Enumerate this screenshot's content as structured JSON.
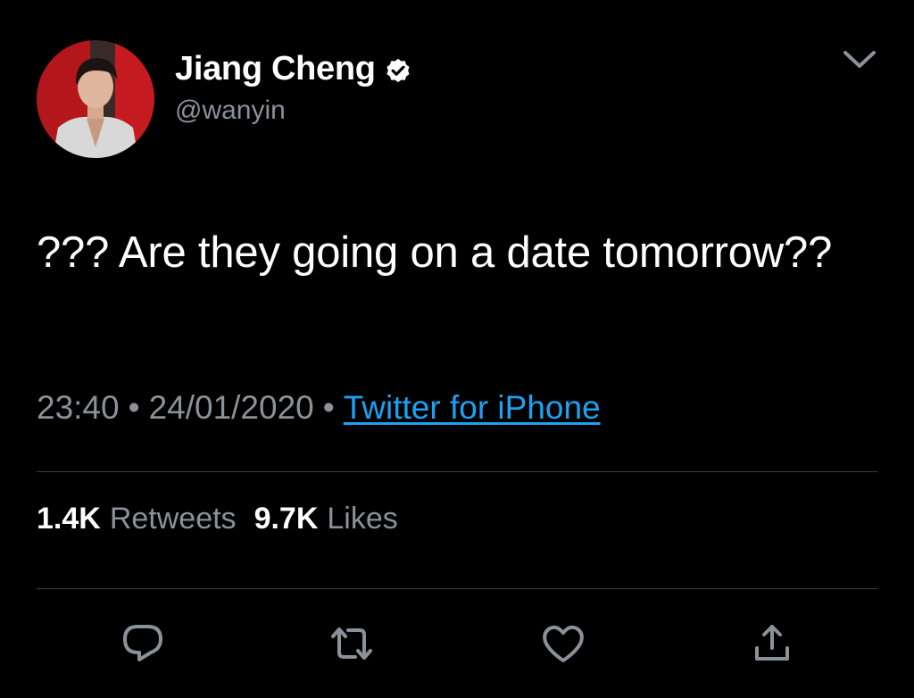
{
  "author": {
    "display_name": "Jiang Cheng",
    "handle": "@wanyin",
    "verified": true
  },
  "tweet": {
    "text": "??? Are they going on a date tomorrow??",
    "time": "23:40",
    "date": "24/01/2020",
    "separator": "•",
    "source": "Twitter for iPhone"
  },
  "stats": {
    "retweets_count": "1.4K",
    "retweets_label": "Retweets",
    "likes_count": "9.7K",
    "likes_label": "Likes"
  },
  "icons": {
    "verified": "verified-badge-icon",
    "menu": "chevron-down-icon",
    "reply": "reply-icon",
    "retweet": "retweet-icon",
    "like": "heart-icon",
    "share": "share-icon"
  },
  "colors": {
    "background": "#000000",
    "primary_text": "#ffffff",
    "secondary_text": "#8a9199",
    "link": "#1da1f2",
    "divider": "#3a3d41"
  }
}
